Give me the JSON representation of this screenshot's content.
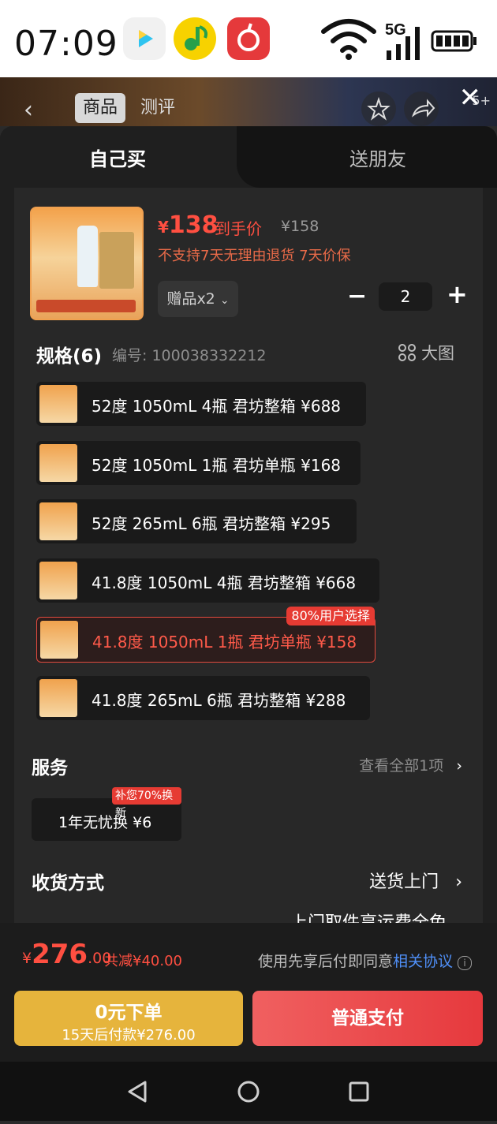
{
  "status_bar": {
    "time": "07:09",
    "network": "5G"
  },
  "background_page": {
    "tab_active": "商品",
    "tab_other": "测评",
    "badge": "5+"
  },
  "sheet": {
    "tabs": {
      "self": "自己买",
      "friend": "送朋友"
    },
    "product": {
      "price_yen": "¥",
      "price": "138",
      "price_tag": "到手价",
      "original_price": "¥158",
      "note": "不支持7天无理由退货 7天价保",
      "gift_label": "赠品x2",
      "quantity": "2"
    },
    "spec": {
      "title": "规格(6)",
      "code": "编号: 100038332212",
      "big_image": "大图",
      "items": [
        {
          "label": "52度 1050mL 4瓶 君坊整箱  ¥688"
        },
        {
          "label": "52度 1050mL 1瓶 君坊单瓶  ¥168"
        },
        {
          "label": "52度 265mL 6瓶 君坊整箱  ¥295"
        },
        {
          "label": "41.8度 1050mL 4瓶 君坊整箱  ¥668"
        },
        {
          "label": "41.8度 1050mL 1瓶 君坊单瓶  ¥158",
          "badge": "80%用户选择"
        },
        {
          "label": "41.8度 265mL 6瓶 君坊整箱  ¥288"
        }
      ]
    },
    "service": {
      "title": "服务",
      "view_all": "查看全部1项",
      "item_label": "1年无忧换 ¥6",
      "item_badge": "补您70%换新"
    },
    "shipping": {
      "title": "收货方式",
      "value": "送货上门",
      "note": "上门取件享运费全免"
    }
  },
  "footer": {
    "total_yen": "¥",
    "total_int": "276",
    "total_dec": ".00",
    "saved": "共减¥40.00",
    "agree_text": "使用先享后付即同意",
    "agree_link": "相关协议",
    "btn_left_line1": "0元下单",
    "btn_left_line2": "15天后付款¥276.00",
    "btn_right": "普通支付"
  },
  "colors": {
    "accent": "#ff4f41",
    "gold": "#e6b43c",
    "link": "#4f8ff7"
  }
}
